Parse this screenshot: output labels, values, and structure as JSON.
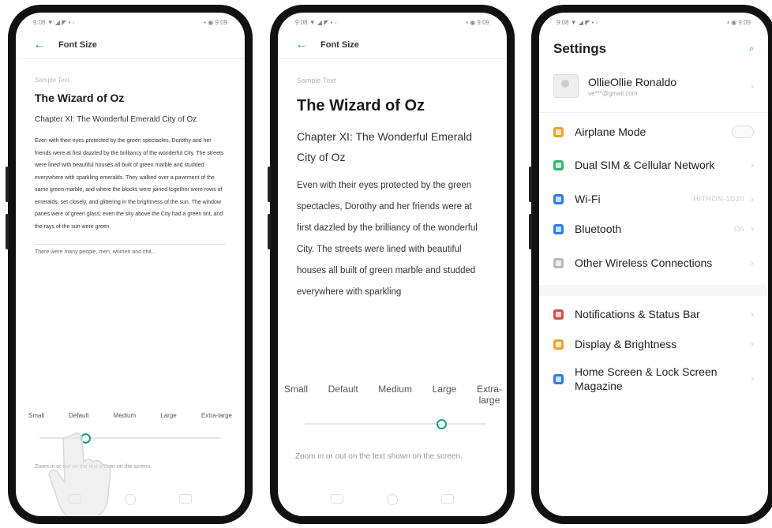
{
  "status_left": "9:08 ▼ ◢ ◤ ▪ ◦",
  "status_right": "▪ ◉ 9:09",
  "font_screen": {
    "title": "Font Size",
    "sample_label": "Sample Text",
    "book_title": "The Wizard of Oz",
    "chapter": "Chapter XI: The Wonderful Emerald City of Oz",
    "paragraph": "Even with their eyes protected by the green spectacles, Dorothy and her friends were at first dazzled by the brilliancy of the wonderful City. The streets were lined with beautiful houses all built of green marble and studded everywhere with sparkling emeralds. They walked over a pavement of the same green marble, and where the blocks were joined together were rows of emeralds, set closely, and glittering in the brightness of the sun. The window panes were of green glass; even the sky above the City had a green tint, and the rays of the sun were green.",
    "paragraph_next": "There were many people, men, women and chil...",
    "paragraph_large": "Even with their eyes protected by the green spectacles, Dorothy and her friends were at first dazzled by the brilliancy of the wonderful City. The streets were lined with beautiful houses all built of green marble and studded everywhere with sparkling",
    "sizes": [
      "Small",
      "Default",
      "Medium",
      "Large",
      "Extra-large"
    ],
    "sizes_large": [
      "Small",
      "Default",
      "Medium",
      "Large",
      "Extra-\nlarge"
    ],
    "hint": "Zoom in or out on the text shown on the screen.",
    "slider_level_phone1": 0.25,
    "slider_level_phone2": 0.75
  },
  "settings": {
    "title": "Settings",
    "account_name": "OllieOllie Ronaldo",
    "account_email": "ve***@gmail.com",
    "rows": [
      {
        "label": "Airplane Mode",
        "value": "",
        "color": "#f0a22a",
        "control": "toggle"
      },
      {
        "label": "Dual SIM & Cellular Network",
        "value": "",
        "color": "#33b56a",
        "control": "chevron"
      },
      {
        "label": "Wi-Fi",
        "value": "HITRON-1D20",
        "color": "#2f7de1",
        "control": "chevron"
      },
      {
        "label": "Bluetooth",
        "value": "On",
        "color": "#2f7de1",
        "control": "chevron"
      },
      {
        "label": "Other Wireless Connections",
        "value": "",
        "color": "#b9b9b9",
        "control": "chevron"
      },
      {
        "label": "Notifications & Status Bar",
        "value": "",
        "color": "#e24848",
        "control": "chevron"
      },
      {
        "label": "Display & Brightness",
        "value": "",
        "color": "#f0a22a",
        "control": "chevron"
      },
      {
        "label": "Home Screen & Lock Screen Magazine",
        "value": "",
        "color": "#2f7de1",
        "control": "chevron"
      }
    ]
  },
  "accent_color": "#1aa08a"
}
